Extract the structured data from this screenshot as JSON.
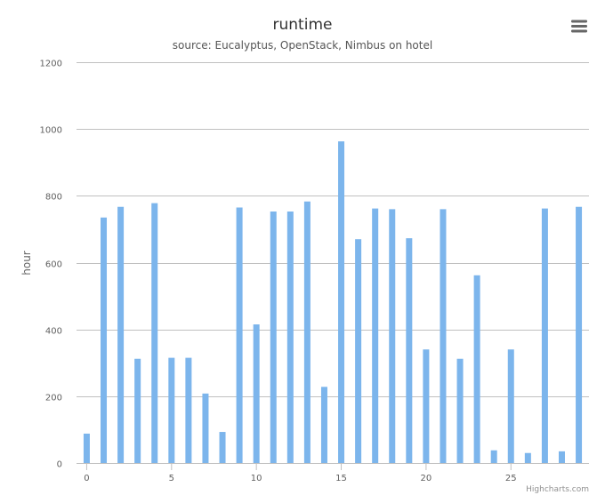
{
  "chart_data": {
    "type": "bar",
    "title": "runtime",
    "subtitle": "source: Eucalyptus, OpenStack, Nimbus on hotel",
    "xlabel": "",
    "ylabel": "hour",
    "x": [
      0,
      1,
      2,
      3,
      4,
      5,
      6,
      7,
      8,
      9,
      10,
      11,
      12,
      13,
      14,
      15,
      16,
      17,
      18,
      19,
      20,
      21,
      22,
      23,
      24,
      25,
      26,
      27,
      28,
      29
    ],
    "values": [
      88,
      735,
      767,
      312,
      778,
      315,
      315,
      208,
      93,
      765,
      415,
      753,
      753,
      783,
      228,
      963,
      670,
      762,
      760,
      673,
      340,
      760,
      312,
      562,
      38,
      340,
      30,
      762,
      35,
      767
    ],
    "xticks": [
      "0",
      "5",
      "10",
      "15",
      "20",
      "25"
    ],
    "yticks": [
      "0",
      "200",
      "400",
      "600",
      "800",
      "1000",
      "1200"
    ],
    "ylim": [
      0,
      1200
    ],
    "xlim": [
      -0.6,
      29.6
    ],
    "grid": true,
    "legend": "none",
    "bar_color": "#7cb5ec",
    "grid_color": "#c0c0c0"
  },
  "credits": "Highcharts.com",
  "menu_icon": "hamburger-menu-icon"
}
